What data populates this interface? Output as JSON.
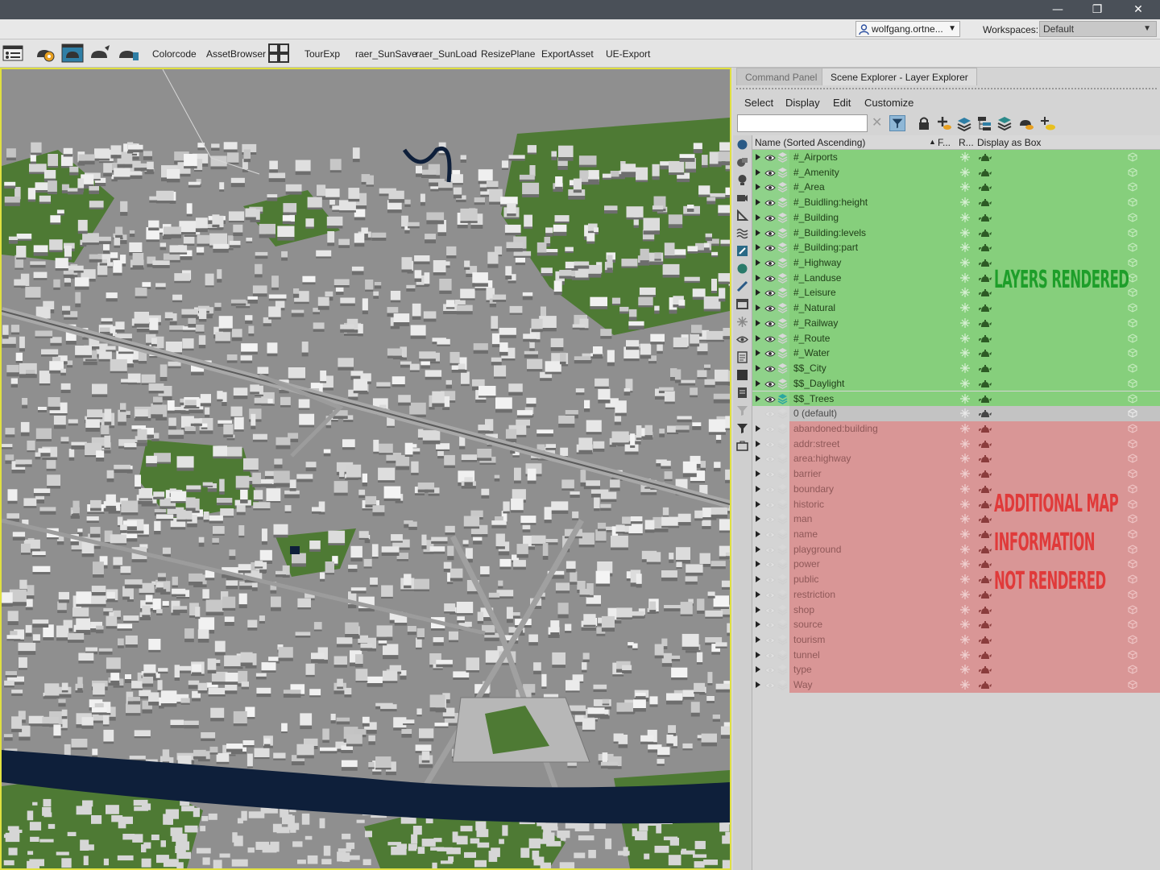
{
  "account": {
    "user": "wolfgang.ortne...",
    "workspaces_label": "Workspaces:",
    "workspace_value": "Default"
  },
  "toolbar": {
    "items": [
      {
        "label": "Colorcode"
      },
      {
        "label": "AssetBrowser"
      },
      {
        "label": "TourExp"
      },
      {
        "label": "raer_SunSave"
      },
      {
        "label": "raer_SunLoad"
      },
      {
        "label": "ResizePlane"
      },
      {
        "label": "ExportAsset"
      },
      {
        "label": "UE-Export"
      }
    ]
  },
  "panel": {
    "tabs": [
      {
        "label": "Command Panel"
      },
      {
        "label": "Scene Explorer - Layer Explorer"
      }
    ],
    "menu": [
      {
        "label": "Select"
      },
      {
        "label": "Display"
      },
      {
        "label": "Edit"
      },
      {
        "label": "Customize"
      }
    ],
    "search": {
      "value": "",
      "placeholder": ""
    },
    "columns": {
      "name": "Name (Sorted Ascending)",
      "freeze": "F...",
      "render": "R...",
      "box": "Display as Box"
    },
    "layers_rendered": [
      "#_Airports",
      "#_Amenity",
      "#_Area",
      "#_Buidling:height",
      "#_Building",
      "#_Building:levels",
      "#_Building:part",
      "#_Highway",
      "#_Landuse",
      "#_Leisure",
      "#_Natural",
      "#_Railway",
      "#_Route",
      "#_Water",
      "$$_City",
      "$$_Daylight",
      "$$_Trees"
    ],
    "default_layer": "0 (default)",
    "layers_not_rendered": [
      "abandoned:building",
      "addr:street",
      "area:highway",
      "barrier",
      "boundary",
      "historic",
      "man",
      "name",
      "playground",
      "power",
      "public",
      "restriction",
      "shop",
      "source",
      "tourism",
      "tunnel",
      "type",
      "Way"
    ],
    "annotation_rendered": "LAYERS RENDERED",
    "annotation_not_rendered": [
      "ADDITIONAL MAP",
      "INFORMATION",
      "NOT RENDERED"
    ],
    "colors": {
      "rendered_band": "#86cf7c",
      "not_rendered_band": "#d99696",
      "annotation_green": "#1e9e2a",
      "annotation_red": "#e03a3a",
      "viewport_border": "#e0e040"
    }
  },
  "viewport": {
    "description_icon": "city-3d-view"
  }
}
